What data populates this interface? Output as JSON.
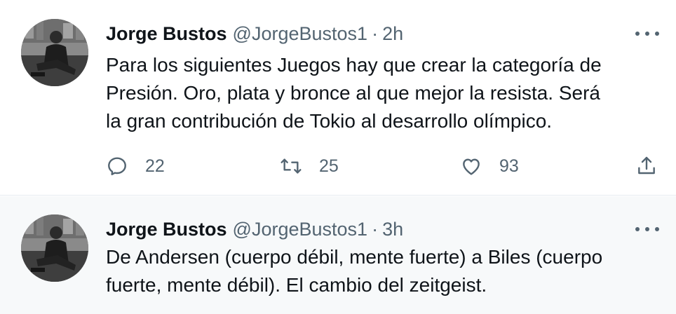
{
  "tweets": [
    {
      "author_name": "Jorge Bustos",
      "handle": "@JorgeBustos1",
      "separator": "·",
      "time": "2h",
      "text_lines": [
        "Para los siguientes Juegos hay que crear la categoría de",
        "Presión. Oro, plata y bronce al que mejor la resista. Será",
        "la gran contribución de Tokio al desarrollo olímpico."
      ],
      "reply_count": "22",
      "retweet_count": "25",
      "like_count": "93",
      "icons": [
        "reply-icon",
        "retweet-icon",
        "like-icon",
        "share-icon",
        "more-icon"
      ]
    },
    {
      "author_name": "Jorge Bustos",
      "handle": "@JorgeBustos1",
      "separator": "·",
      "time": "3h",
      "text_lines": [
        "De Andersen (cuerpo débil, mente fuerte) a Biles (cuerpo",
        "fuerte, mente débil). El cambio del zeitgeist."
      ],
      "icons": [
        "more-icon"
      ]
    }
  ],
  "colors": {
    "text_primary": "#0f1419",
    "text_secondary": "#536471",
    "divider": "#e6ecf0",
    "highlight_background": "#f7f9fa"
  }
}
